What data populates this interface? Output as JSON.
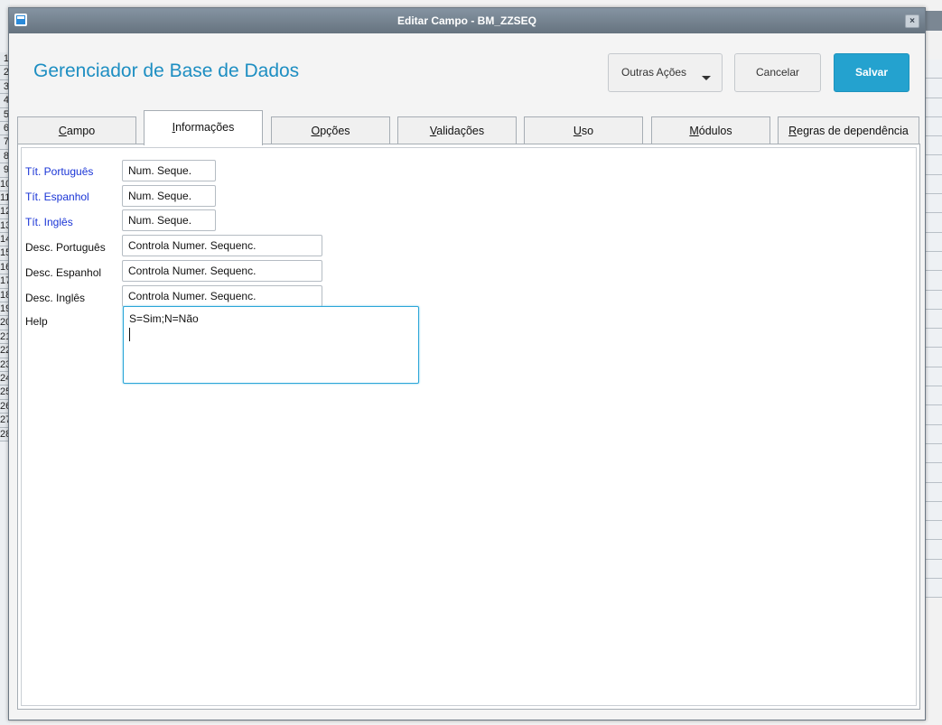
{
  "window": {
    "title": "Editar Campo - BM_ZZSEQ",
    "close_glyph": "×"
  },
  "background_rows": [
    "1",
    "2",
    "3",
    "4",
    "5",
    "6",
    "7",
    "8",
    "9",
    "10",
    "11",
    "12",
    "13",
    "14",
    "15",
    "16",
    "17",
    "18",
    "19",
    "20",
    "21",
    "22",
    "23",
    "24",
    "25",
    "26",
    "27",
    "28"
  ],
  "header": {
    "app_title": "Gerenciador de Base de Dados",
    "other_actions_label": "Outras Ações",
    "cancel_label": "Cancelar",
    "save_label": "Salvar"
  },
  "tabs": [
    {
      "label": "Campo",
      "underline": "C",
      "rest": "ampo",
      "active": false
    },
    {
      "label": "Informações",
      "underline": "I",
      "rest": "nformações",
      "active": true
    },
    {
      "label": "Opções",
      "underline": "O",
      "rest": "pções",
      "active": false
    },
    {
      "label": "Validações",
      "underline": "V",
      "rest": "alidações",
      "active": false
    },
    {
      "label": "Uso",
      "underline": "U",
      "rest": "so",
      "active": false
    },
    {
      "label": "Módulos",
      "underline": "M",
      "rest": "ódulos",
      "active": false
    },
    {
      "label": "Regras de dependência",
      "underline": "R",
      "rest": "egras de dependência",
      "active": false
    }
  ],
  "fields": {
    "tit_portugues": {
      "label": "Tít. Português",
      "value": "Num. Seque."
    },
    "tit_espanhol": {
      "label": "Tít. Espanhol",
      "value": "Num. Seque."
    },
    "tit_ingles": {
      "label": "Tít. Inglês",
      "value": "Num. Seque."
    },
    "desc_portugues": {
      "label": "Desc. Português",
      "value": "Controla Numer. Sequenc."
    },
    "desc_espanhol": {
      "label": "Desc. Espanhol",
      "value": "Controla Numer. Sequenc."
    },
    "desc_ingles": {
      "label": "Desc. Inglês",
      "value": "Controla Numer. Sequenc."
    },
    "help": {
      "label": "Help",
      "value": "S=Sim;N=Não"
    }
  },
  "colors": {
    "accent": "#24a2cf",
    "title_text": "#1d8ec2",
    "required_label": "#1a35d6"
  }
}
